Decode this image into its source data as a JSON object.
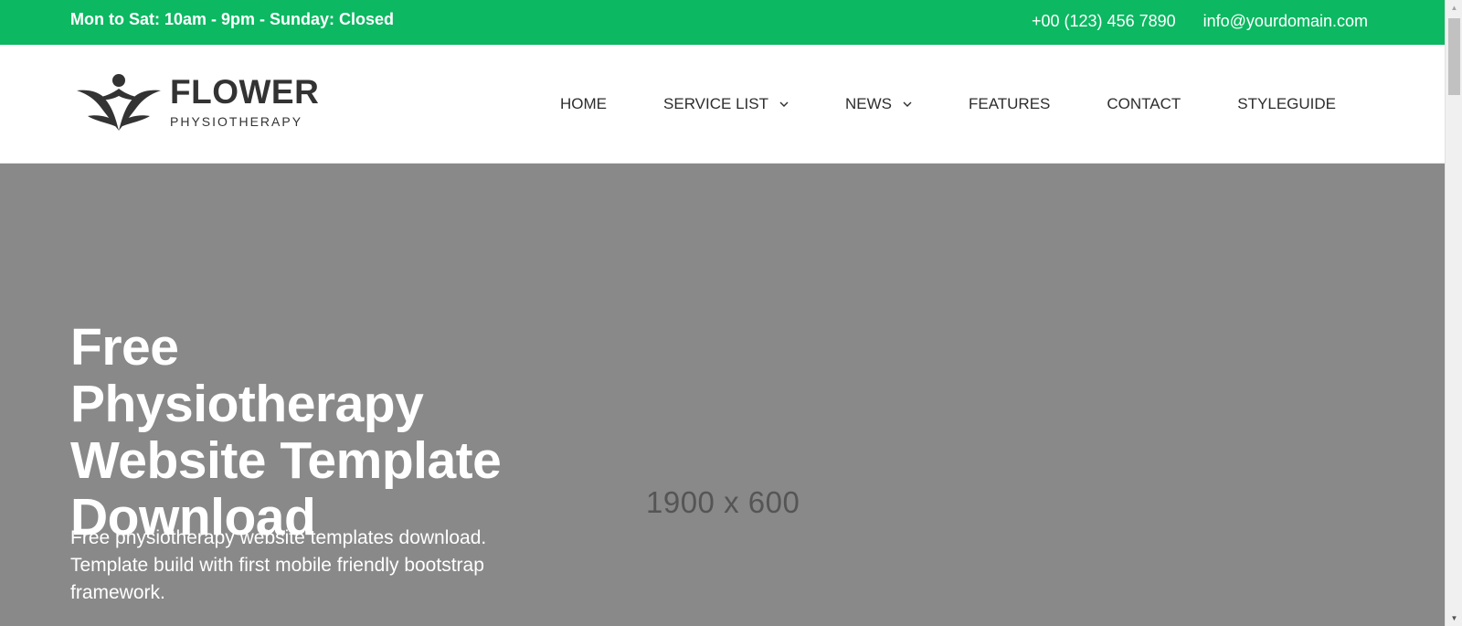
{
  "topbar": {
    "hours": "Mon to Sat: 10am - 9pm - Sunday: Closed",
    "phone": "+00 (123) 456 7890",
    "email": "info@yourdomain.com",
    "bg_color": "#0cb862"
  },
  "logo": {
    "title": "FLOWER",
    "subtitle": "PHYSIOTHERAPY",
    "icon": "flower-person-icon"
  },
  "nav": {
    "items": [
      {
        "label": "HOME",
        "has_dropdown": false
      },
      {
        "label": "SERVICE LIST",
        "has_dropdown": true
      },
      {
        "label": "NEWS",
        "has_dropdown": true
      },
      {
        "label": "FEATURES",
        "has_dropdown": false
      },
      {
        "label": "CONTACT",
        "has_dropdown": false
      },
      {
        "label": "STYLEGUIDE",
        "has_dropdown": false
      }
    ]
  },
  "hero": {
    "title": "Free Physiotherapy Website Template Download",
    "text": "Free physiotherapy website templates download. Template build with first mobile friendly bootstrap framework.",
    "placeholder": "1900 x 600",
    "bg_color": "#898989"
  }
}
